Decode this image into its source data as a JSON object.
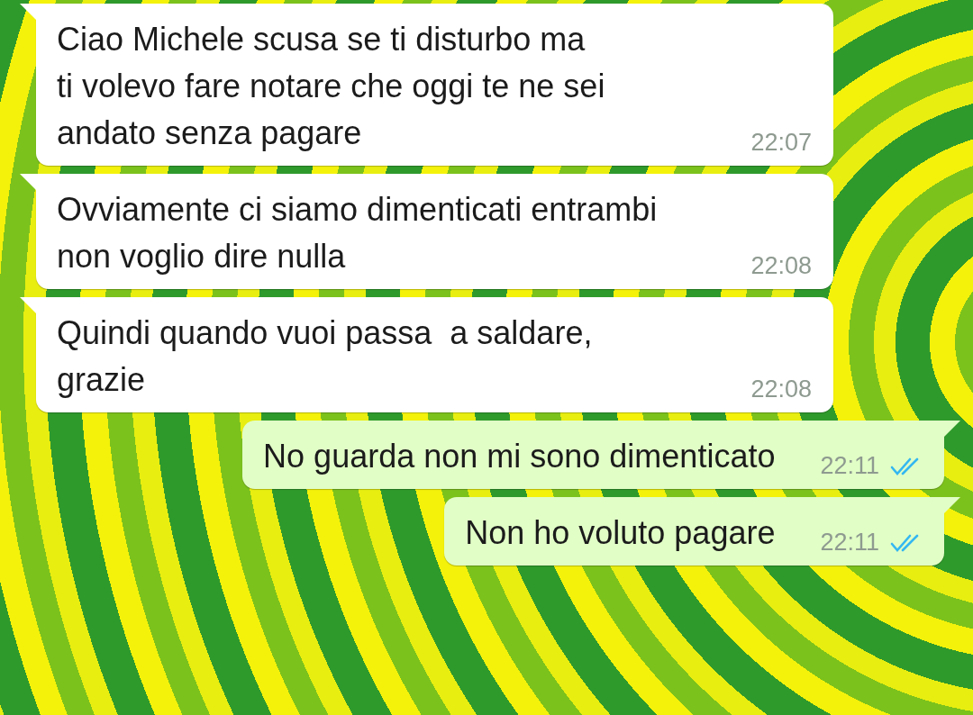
{
  "messages": [
    {
      "kind": "incoming",
      "text": "Ciao Michele scusa se ti disturbo ma\nti volevo fare notare che oggi te ne sei\nandato senza pagare",
      "time": "22:07"
    },
    {
      "kind": "incoming",
      "text": "Ovviamente ci siamo dimenticati entrambi\nnon voglio dire nulla",
      "time": "22:08"
    },
    {
      "kind": "incoming",
      "text": "Quindi quando vuoi passa  a saldare,\ngrazie",
      "time": "22:08"
    },
    {
      "kind": "outgoing",
      "text": "No guarda non mi sono dimenticato",
      "time": "22:11",
      "read": true
    },
    {
      "kind": "outgoing",
      "text": "Non ho voluto pagare",
      "time": "22:11",
      "read": true
    }
  ]
}
